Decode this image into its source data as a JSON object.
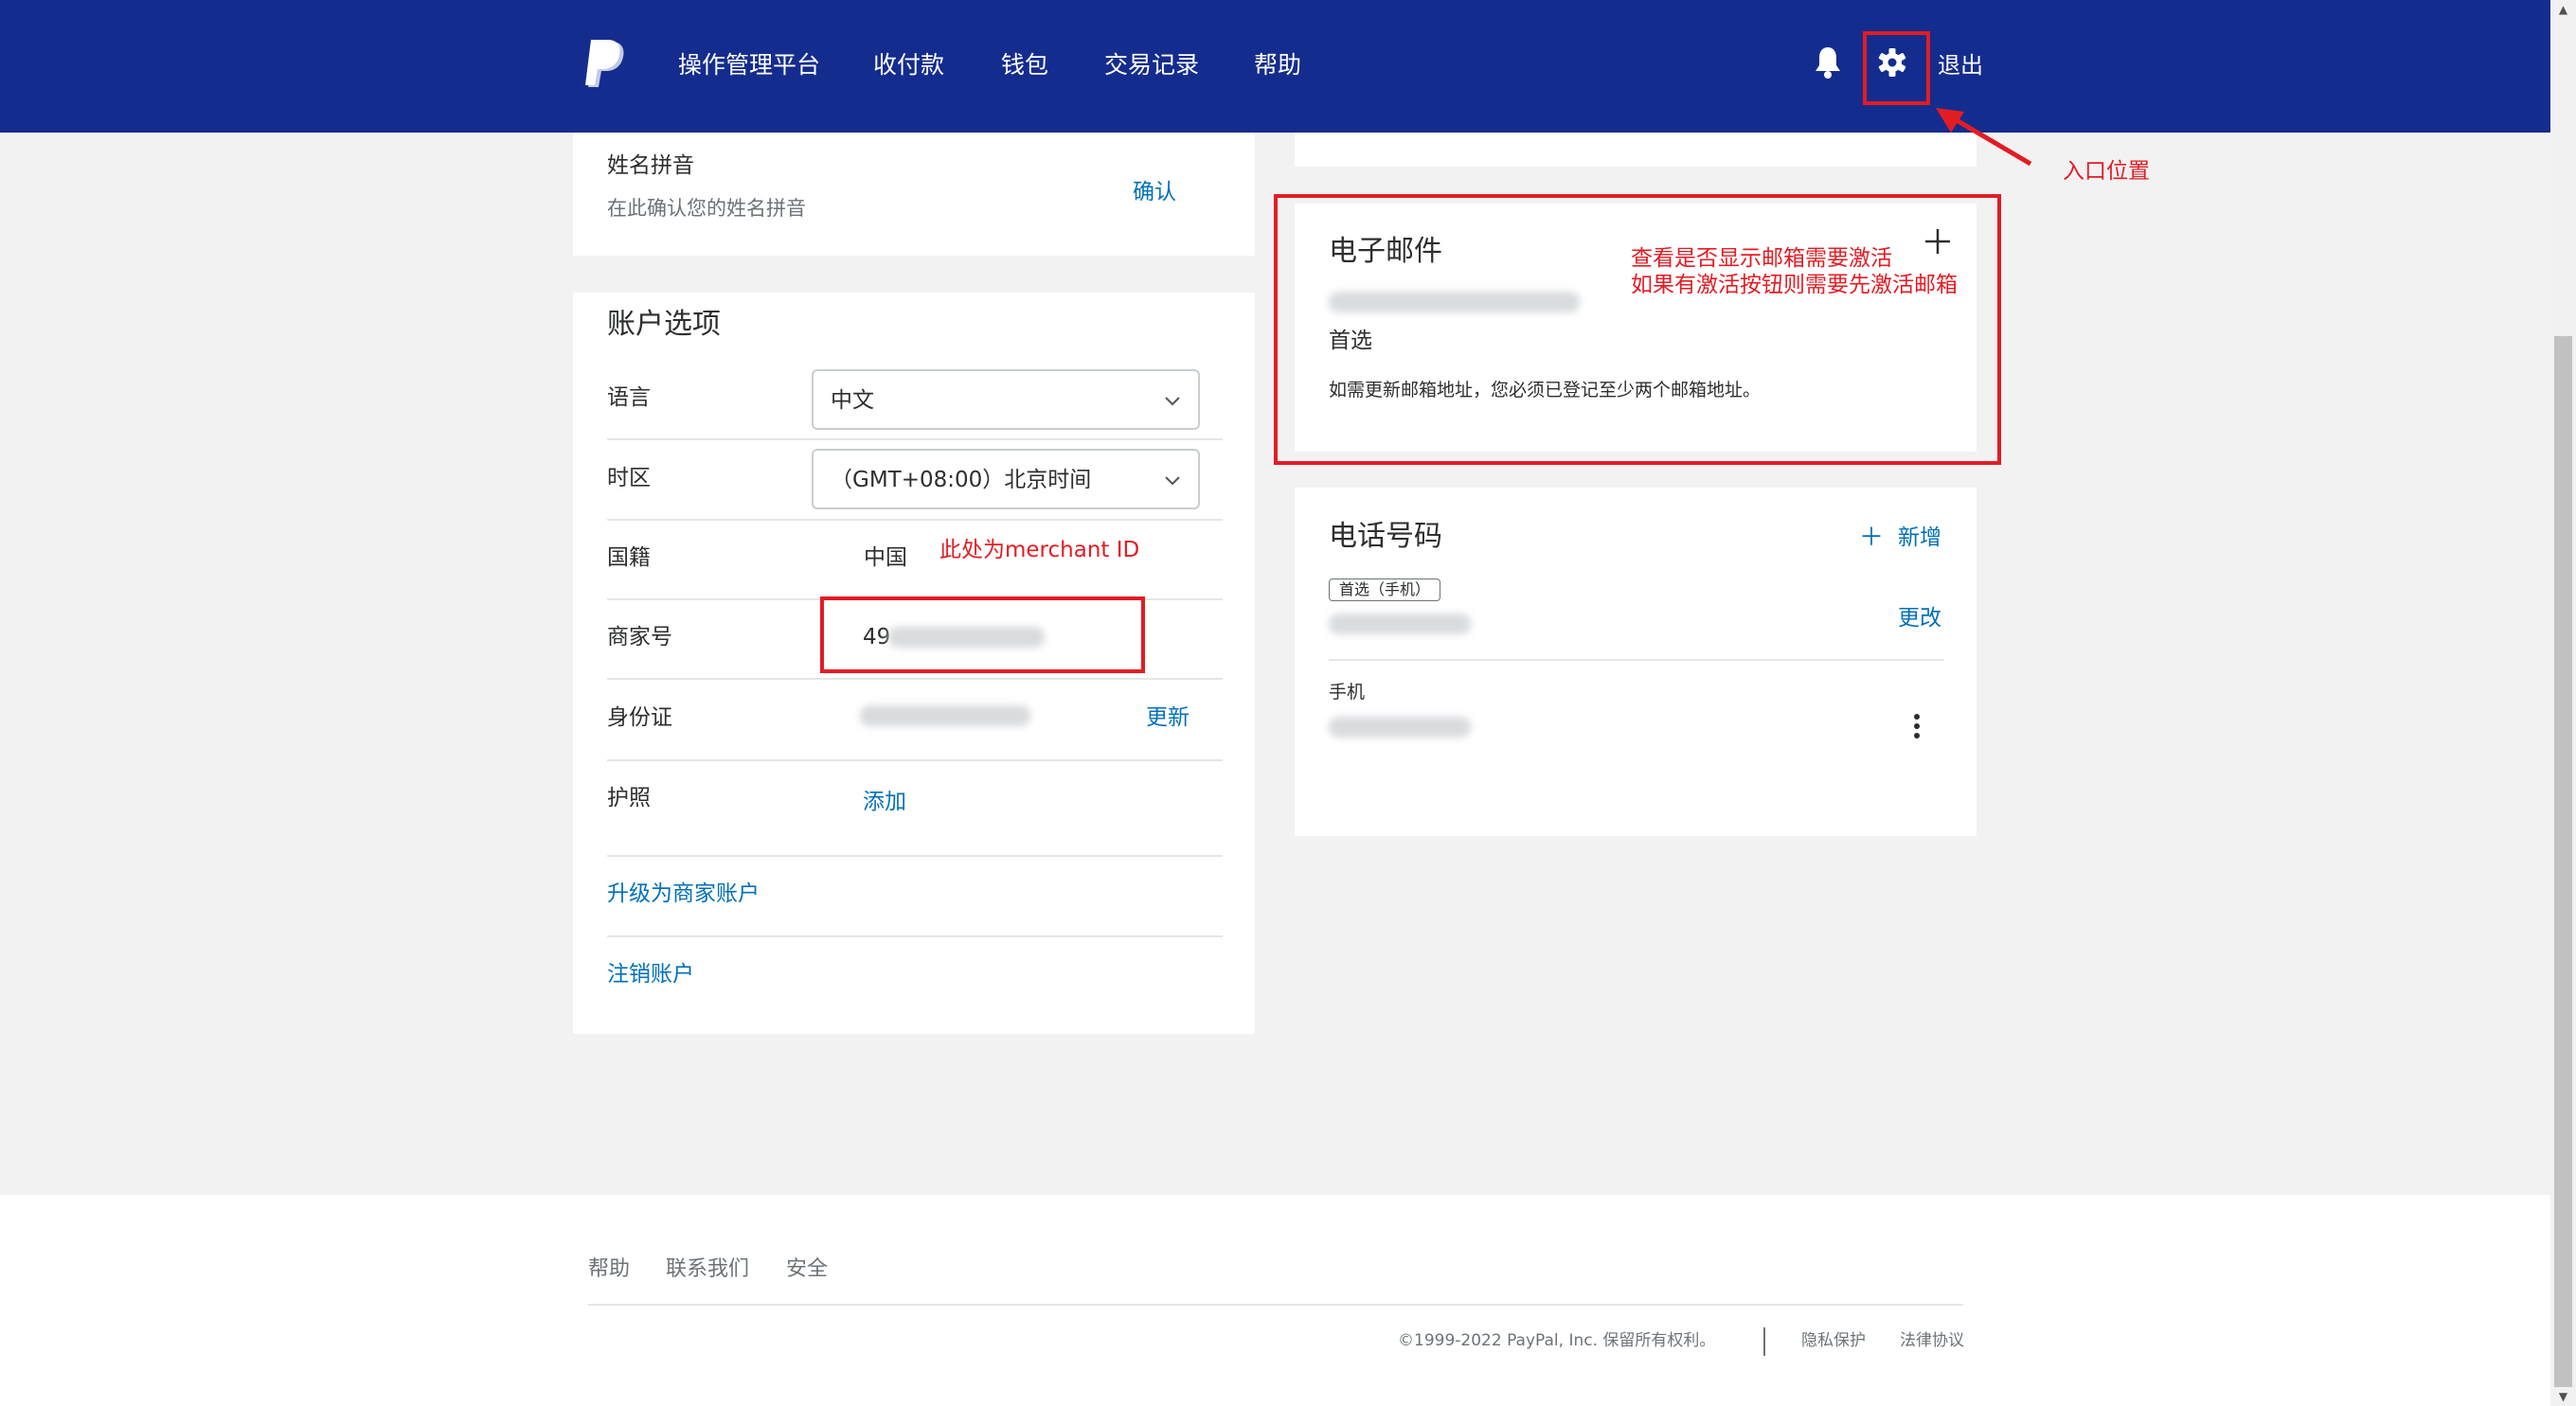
{
  "nav": {
    "items": [
      "操作管理平台",
      "收付款",
      "钱包",
      "交易记录",
      "帮助"
    ],
    "logout": "退出"
  },
  "name_pinyin": {
    "title": "姓名拼音",
    "desc": "在此确认您的姓名拼音",
    "confirm": "确认"
  },
  "account": {
    "heading": "账户选项",
    "language_label": "语言",
    "language_value": "中文",
    "timezone_label": "时区",
    "timezone_value": "（GMT+08:00）北京时间",
    "nationality_label": "国籍",
    "nationality_value": "中国",
    "merchant_label": "商家号",
    "merchant_value": "49",
    "id_label": "身份证",
    "id_action": "更新",
    "passport_label": "护照",
    "passport_action": "添加",
    "upgrade": "升级为商家账户",
    "close_account": "注销账户"
  },
  "email": {
    "heading": "电子邮件",
    "preferred": "首选",
    "note": "如需更新邮箱地址，您必须已登记至少两个邮箱地址。",
    "add_icon": "plus-icon"
  },
  "phone": {
    "heading": "电话号码",
    "add": "新增",
    "badge": "首选（手机）",
    "change": "更改",
    "mobile_label": "手机"
  },
  "annotations": {
    "entry": "入口位置",
    "email_check_1": "查看是否显示邮箱需要激活",
    "email_check_2": "如果有激活按钮则需要先激活邮箱",
    "merchant_id": "此处为merchant ID"
  },
  "footer": {
    "links": [
      "帮助",
      "联系我们",
      "安全"
    ],
    "copyright": "©1999-2022 PayPal, Inc. 保留所有权利。",
    "privacy": "隐私保护",
    "legal": "法律协议"
  },
  "colors": {
    "nav_bg": "#142c8e",
    "link": "#0070ba",
    "annotation": "#e31c23"
  }
}
